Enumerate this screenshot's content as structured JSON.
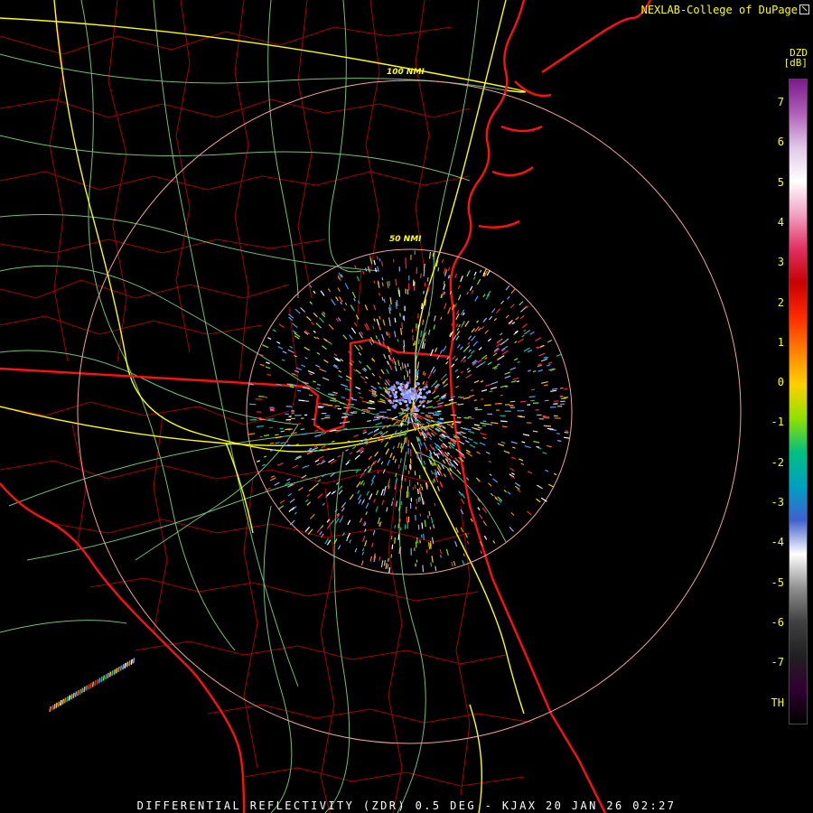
{
  "credit": "NEXLAB-College of DuPage",
  "credit_icon": "external-link-icon",
  "footer": "DIFFERENTIAL REFLECTIVITY (ZDR) 0.5 DEG - KJAX 20 JAN 26 02:27",
  "legend": {
    "title": "DZD",
    "unit": "[dB]",
    "ticks": [
      "7",
      "6",
      "5",
      "4",
      "3",
      "2",
      "1",
      "0",
      "-1",
      "-2",
      "-3",
      "-4",
      "-5",
      "-6",
      "-7",
      "TH"
    ],
    "colors": [
      "#7a1a8a",
      "#b060b8",
      "#e0c8e8",
      "#ffffff",
      "#f0a0c0",
      "#e03060",
      "#c80000",
      "#ff2a00",
      "#ff8000",
      "#ffd000",
      "#90e000",
      "#00c080",
      "#00a0c0",
      "#4060d0",
      "#ffffff",
      "#909090",
      "#404040",
      "#202020",
      "#300030",
      "#000000"
    ]
  },
  "range_rings": [
    {
      "label": "50 NMI"
    },
    {
      "label": "100 NMI"
    }
  ],
  "colors": {
    "state_border": "#ff0000",
    "county_line": "#a00000",
    "highway": "#ffff00",
    "road": "#80d080",
    "range_ring": "#f0a0a0",
    "text": "#ffff00"
  }
}
